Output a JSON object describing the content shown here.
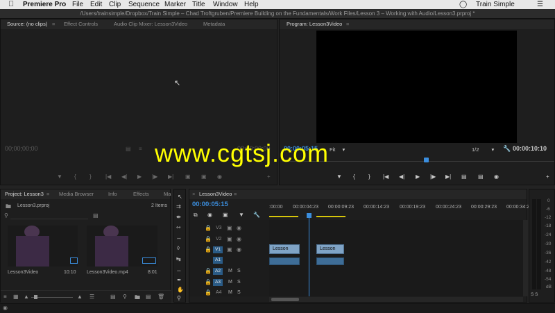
{
  "menubar": {
    "app": "Premiere Pro",
    "items": [
      "File",
      "Edit",
      "Clip",
      "Sequence",
      "Marker",
      "Title",
      "Window",
      "Help"
    ],
    "account": "Train Simple"
  },
  "path": "/Users/trainsimple/Dropbox/Train Simple – Chad Troftgruben/Premiere Building on the Fundamentals/Work Files/Lesson 3 – Working with Audio/Lesson3.prproj *",
  "source_panel": {
    "tabs": [
      "Source: (no clips)",
      "Effect Controls",
      "Audio Clip Mixer: Lesson3Video",
      "Metadata"
    ],
    "timecode_left": "00;00;00;00",
    "timecode_right": "00;00;00;00"
  },
  "program_panel": {
    "tab": "Program: Lesson3Video",
    "timecode_left": "00:00:05:15",
    "fit": "Fit",
    "resolution": "1/2",
    "timecode_right": "00:00:10:10"
  },
  "watermark": "www.cgtsj.com",
  "project_panel": {
    "tabs": [
      "Project: Lesson3",
      "Media Browser",
      "Info",
      "Effects",
      "Ma"
    ],
    "file": "Lesson3.prproj",
    "count": "2 Items",
    "items": [
      {
        "name": "Lesson3Video",
        "duration": "10:10"
      },
      {
        "name": "Lesson3Video.mp4",
        "duration": "8:01"
      }
    ]
  },
  "timeline": {
    "tab": "Lesson3Video",
    "timecode": "00:00:05:15",
    "ruler": [
      ":00:00",
      "00:00:04:23",
      "00:00:09:23",
      "00:00:14:23",
      "00:00:19:23",
      "00:00:24:23",
      "00:00:29:23",
      "00:00:34:23"
    ],
    "tracks_video": [
      "V3",
      "V2",
      "V1"
    ],
    "tracks_audio": [
      "A1",
      "A2",
      "A3",
      "A4"
    ],
    "clip_label": "Lesson",
    "mute": "M",
    "solo": "S"
  },
  "meter": {
    "labels": [
      "0",
      "-6",
      "-12",
      "-18",
      "-24",
      "-30",
      "-36",
      "-42",
      "-48",
      "-54",
      "dB"
    ],
    "solo_buttons": "S S"
  },
  "colors": {
    "accent_blue": "#3b8ede",
    "clip_video": "#7fa3c5",
    "clip_audio": "#3e6d97",
    "watermark": "#ffff00",
    "panel_bg": "#1e1e1e"
  }
}
